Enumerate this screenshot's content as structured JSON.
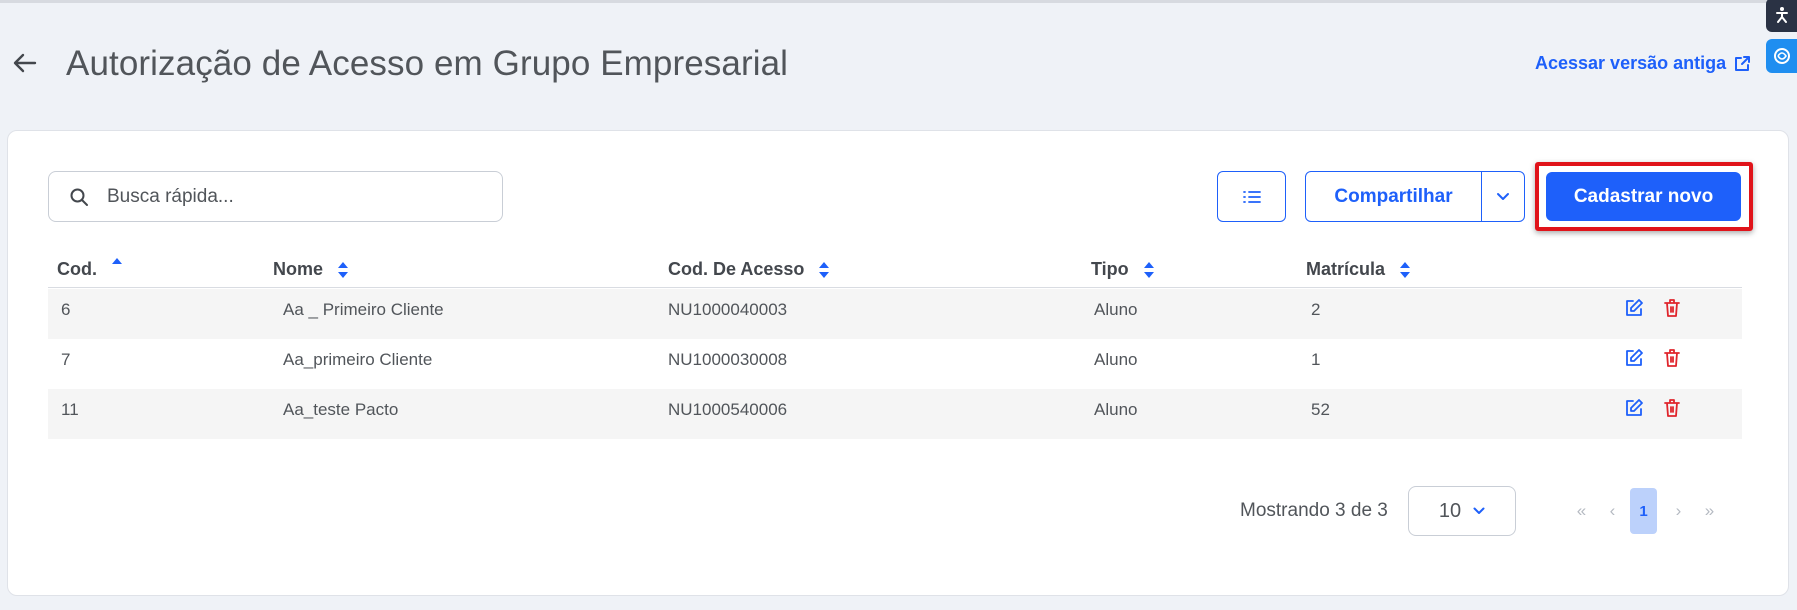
{
  "header": {
    "title": "Autorização de Acesso em Grupo Empresarial",
    "old_version_label": "Acessar versão antiga"
  },
  "toolbar": {
    "search_placeholder": "Busca rápida...",
    "share_label": "Compartilhar",
    "new_label": "Cadastrar novo"
  },
  "table": {
    "columns": [
      "Cod.",
      "Nome",
      "Cod. De Acesso",
      "Tipo",
      "Matrícula"
    ],
    "rows": [
      {
        "cod": "6",
        "nome": "Aa _ Primeiro Cliente",
        "acesso": "NU1000040003",
        "tipo": "Aluno",
        "matricula": "2"
      },
      {
        "cod": "7",
        "nome": "Aa_primeiro Cliente",
        "acesso": "NU1000030008",
        "tipo": "Aluno",
        "matricula": "1"
      },
      {
        "cod": "11",
        "nome": "Aa_teste Pacto",
        "acesso": "NU1000540006",
        "tipo": "Aluno",
        "matricula": "52"
      }
    ]
  },
  "footer": {
    "showing": "Mostrando 3 de 3",
    "page_size": "10",
    "current_page": "1",
    "first": "«",
    "prev": "‹",
    "next": "›",
    "last": "»"
  },
  "colors": {
    "accent": "#1e60fa",
    "highlight": "#e0131a",
    "delete": "#e0252c"
  }
}
